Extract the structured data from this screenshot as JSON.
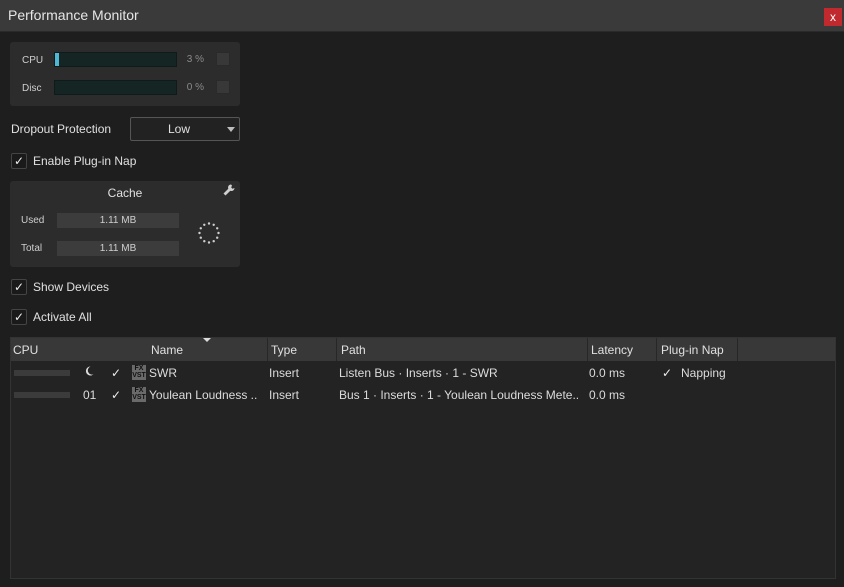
{
  "window": {
    "title": "Performance Monitor",
    "close_label": "x"
  },
  "meters": {
    "cpu": {
      "label": "CPU",
      "value_text": "3 %",
      "level": 0.03
    },
    "disc": {
      "label": "Disc",
      "value_text": "0 %",
      "level": 0.0
    }
  },
  "dropout": {
    "label": "Dropout Protection",
    "value": "Low"
  },
  "plugin_nap": {
    "label": "Enable Plug-in Nap",
    "checked": true
  },
  "cache": {
    "title": "Cache",
    "used_label": "Used",
    "used_value": "1.11 MB",
    "total_label": "Total",
    "total_value": "1.11 MB"
  },
  "show_devices": {
    "label": "Show Devices",
    "checked": true
  },
  "activate_all": {
    "label": "Activate All",
    "checked": true
  },
  "table": {
    "headers": {
      "cpu": "CPU",
      "name": "Name",
      "type": "Type",
      "path": "Path",
      "latency": "Latency",
      "nap": "Plug-in Nap"
    },
    "rows": [
      {
        "cpu_level": 0.0,
        "cpu_text": "",
        "moon": true,
        "active": true,
        "badge": "FX",
        "badge_sub": "VST",
        "name": "SWR",
        "type": "Insert",
        "path": "Listen Bus · Inserts · 1 - SWR",
        "latency": "0.0 ms",
        "nap": "Napping",
        "nap_checked": true
      },
      {
        "cpu_level": 0.0,
        "cpu_text": "01",
        "moon": false,
        "active": true,
        "badge": "FX",
        "badge_sub": "VST",
        "name": "Youlean Loudness ..",
        "type": "Insert",
        "path": "Bus 1 · Inserts · 1 - Youlean Loudness Mete..",
        "latency": "0.0 ms",
        "nap": "",
        "nap_checked": false
      }
    ]
  }
}
